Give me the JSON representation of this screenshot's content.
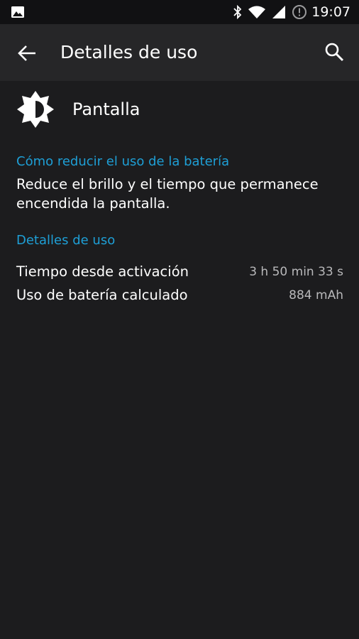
{
  "status_bar": {
    "time": "19:07",
    "icons": [
      "image-notification-icon",
      "bluetooth-icon",
      "wifi-icon",
      "cellular-signal-icon",
      "alert-circle-icon"
    ]
  },
  "app_bar": {
    "title": "Detalles de uso",
    "back_icon": "arrow-back-icon",
    "search_icon": "search-icon"
  },
  "header": {
    "title": "Pantalla",
    "icon": "brightness-icon"
  },
  "tip": {
    "heading": "Cómo reducir el uso de la batería",
    "text": "Reduce el brillo y el tiempo que permanece encendida la pantalla."
  },
  "usage": {
    "heading": "Detalles de uso",
    "rows": [
      {
        "label": "Tiempo desde activación",
        "value": "3 h 50 min 33 s"
      },
      {
        "label": "Uso de batería calculado",
        "value": "884 mAh"
      }
    ]
  },
  "colors": {
    "accent": "#1e9fd6",
    "background": "#1c1c1e",
    "app_bar": "#262628",
    "status_bar": "#111113"
  }
}
